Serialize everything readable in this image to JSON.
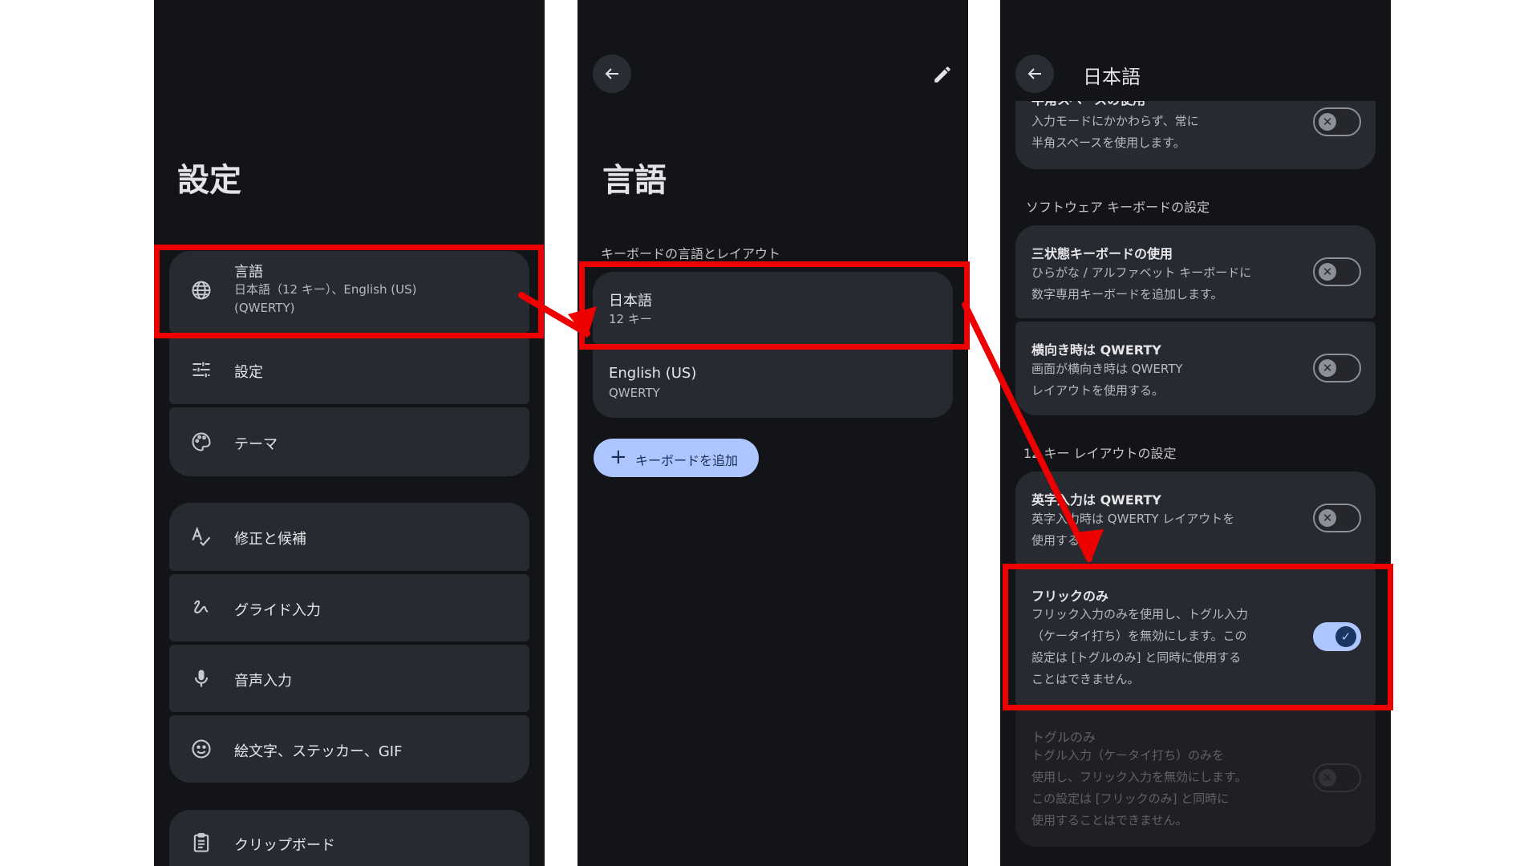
{
  "panel1": {
    "title": "設定",
    "items": [
      {
        "icon": "globe-icon",
        "label": "言語",
        "sub1": "日本語（12 キー）、English (US)",
        "sub2": "(QWERTY)"
      },
      {
        "icon": "sliders-icon",
        "label": "設定"
      },
      {
        "icon": "palette-icon",
        "label": "テーマ"
      },
      {
        "icon": "spellcheck-icon",
        "label": "修正と候補"
      },
      {
        "icon": "gesture-icon",
        "label": "グライド入力"
      },
      {
        "icon": "mic-icon",
        "label": "音声入力"
      },
      {
        "icon": "emoji-icon",
        "label": "絵文字、ステッカー、GIF"
      },
      {
        "icon": "clipboard-icon",
        "label": "クリップボード"
      }
    ]
  },
  "panel2": {
    "title": "言語",
    "section": "キーボードの言語とレイアウト",
    "languages": [
      {
        "name": "日本語",
        "layout": "12 キー"
      },
      {
        "name": "English (US)",
        "layout": "QWERTY"
      }
    ],
    "add_button": "キーボードを追加"
  },
  "panel3": {
    "title": "日本語",
    "top_item": {
      "title": "半角スペースの使用",
      "sub1": "入力モードにかかわらず、常に",
      "sub2": "半角スペースを使用します。",
      "on": false
    },
    "section1": "ソフトウェア キーボードの設定",
    "section1_items": [
      {
        "title": "三状態キーボードの使用",
        "sub1": "ひらがな / アルファベット キーボードに",
        "sub2": "数字専用キーボードを追加します。",
        "on": false
      },
      {
        "title": "横向き時は QWERTY",
        "sub1": "画面が横向き時は QWERTY",
        "sub2": "レイアウトを使用する。",
        "on": false
      }
    ],
    "section2": "12 キー レイアウトの設定",
    "section2_items": [
      {
        "title": "英字入力は QWERTY",
        "sub1": "英字入力時は QWERTY レイアウトを",
        "sub2": "使用する。",
        "on": false
      },
      {
        "title": "フリックのみ",
        "lines": [
          "フリック入力のみを使用し、トグル入力",
          "（ケータイ打ち）を無効にします。この",
          "設定は [トグルのみ] と同時に使用する",
          "ことはできません。"
        ],
        "on": true
      },
      {
        "title": "トグルのみ",
        "lines": [
          "トグル入力（ケータイ打ち）のみを",
          "使用し、フリック入力を無効にします。",
          "この設定は [フリックのみ] と同時に",
          "使用することはできません。"
        ],
        "on": false,
        "disabled": true
      }
    ]
  },
  "colors": {
    "highlight": "#ee0000",
    "accent": "#aec6ff",
    "panel_bg": "#131418",
    "card_bg": "#282a31"
  }
}
